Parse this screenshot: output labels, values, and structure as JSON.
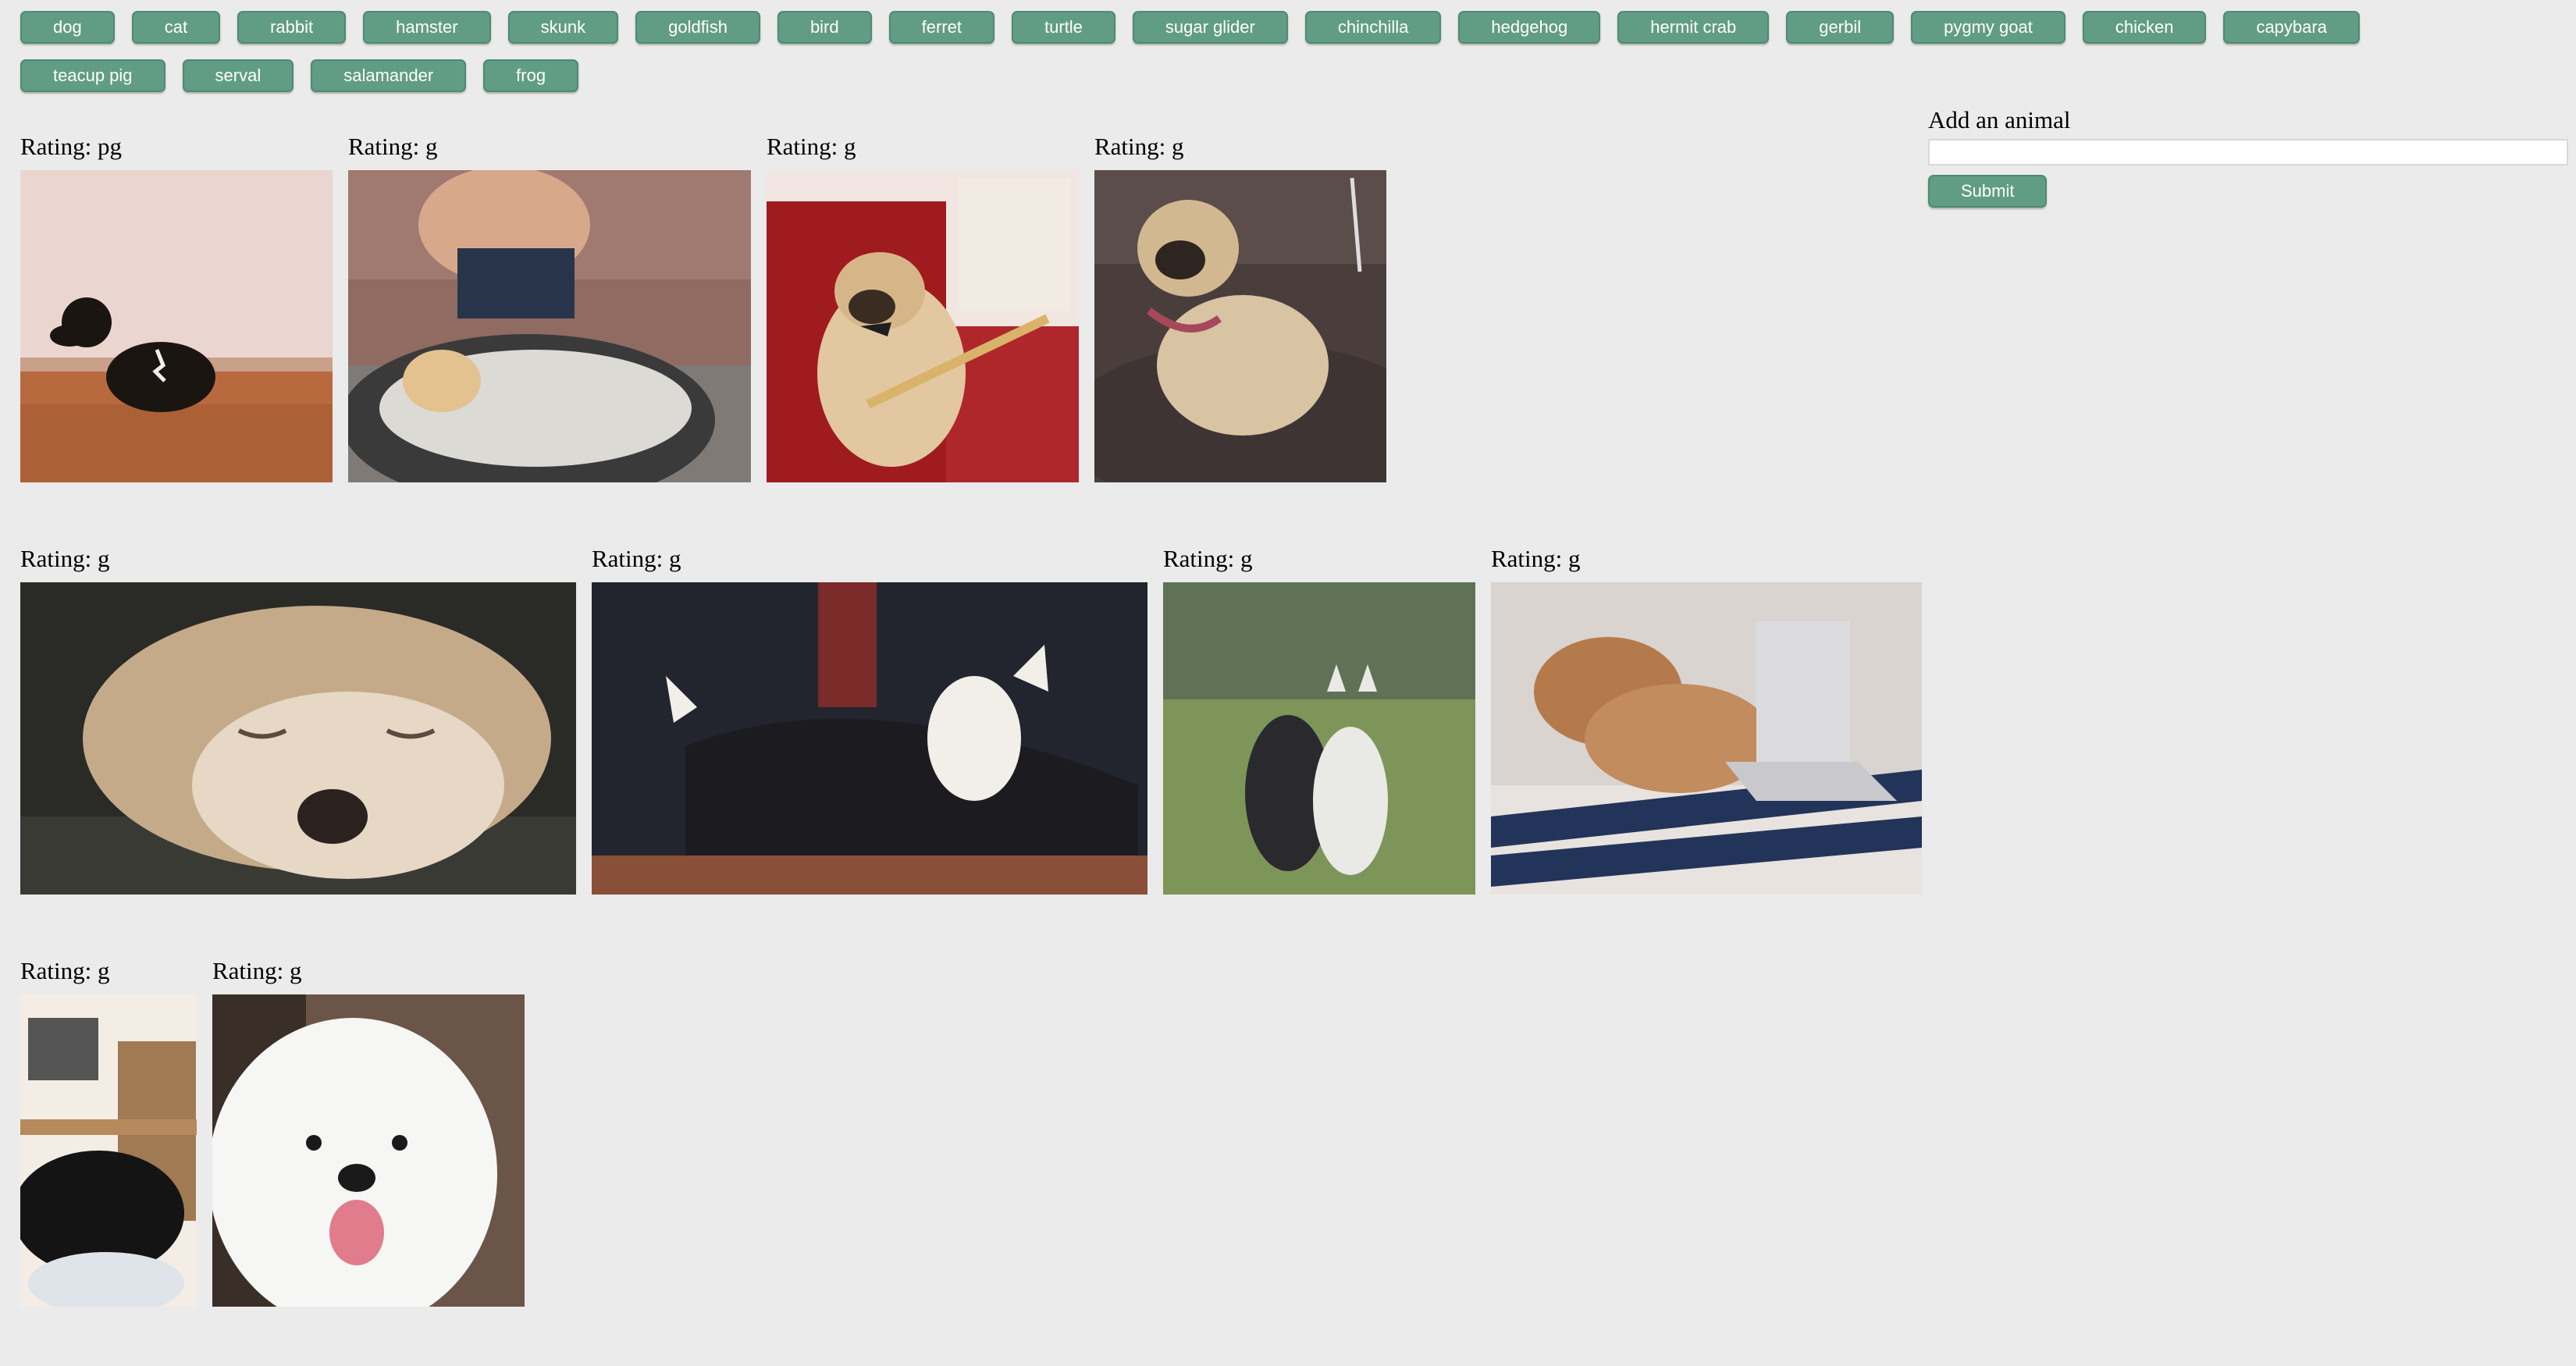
{
  "animals": [
    "dog",
    "cat",
    "rabbit",
    "hamster",
    "skunk",
    "goldfish",
    "bird",
    "ferret",
    "turtle",
    "sugar glider",
    "chinchilla",
    "hedgehog",
    "hermit crab",
    "gerbil",
    "pygmy goat",
    "chicken",
    "capybara",
    "teacup pig",
    "serval",
    "salamander",
    "frog"
  ],
  "form": {
    "label": "Add an animal",
    "input_value": "",
    "submit_label": "Submit"
  },
  "gifs": [
    {
      "rating": "Rating: pg",
      "subject": "dachshund puppy sitting on wood floor"
    },
    {
      "rating": "Rating: g",
      "subject": "boy washing golden retriever in tub"
    },
    {
      "rating": "Rating: g",
      "subject": "pug with bow tie and back scratcher"
    },
    {
      "rating": "Rating: g",
      "subject": "pug lying on couch"
    },
    {
      "rating": "Rating: g",
      "subject": "sleeping terrier close-up"
    },
    {
      "rating": "Rating: g",
      "subject": "chihuahua in black cape"
    },
    {
      "rating": "Rating: g",
      "subject": "two dogs sitting on grass"
    },
    {
      "rating": "Rating: g",
      "subject": "shiba inu at laptop in bed"
    },
    {
      "rating": "Rating: g",
      "subject": "black puppy in living room"
    },
    {
      "rating": "Rating: g",
      "subject": "smiling samoyed"
    }
  ]
}
